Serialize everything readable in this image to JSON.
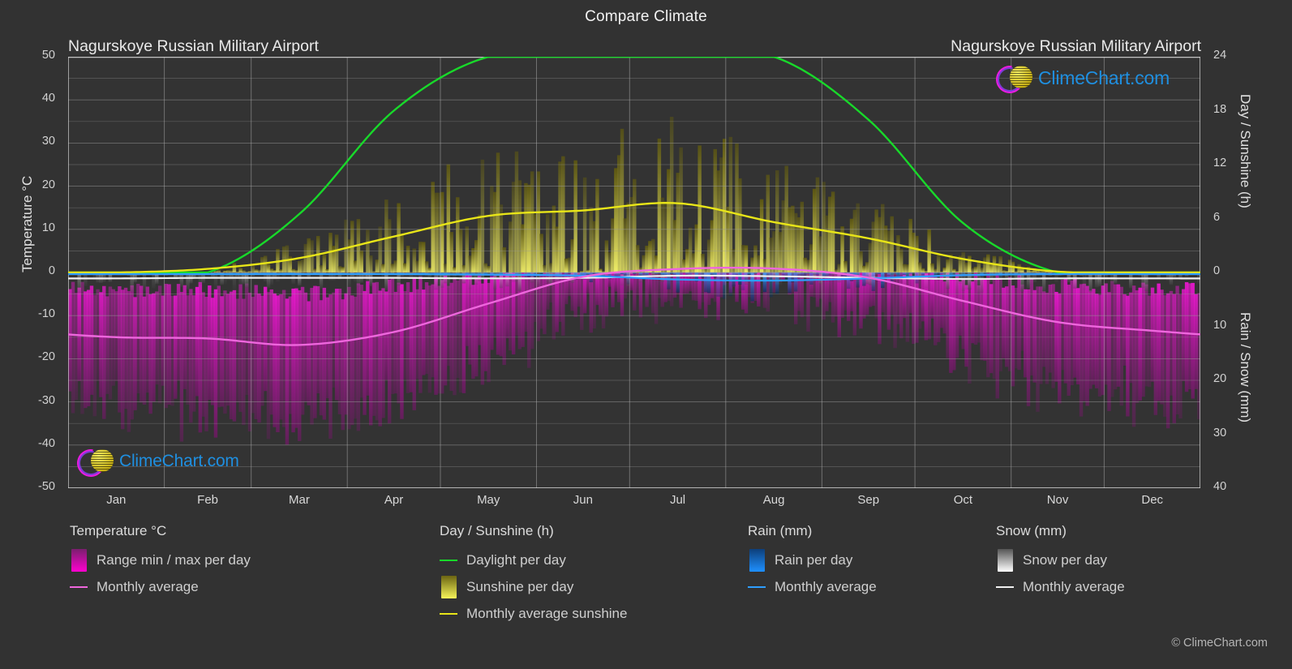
{
  "header": {
    "main_title": "Compare Climate",
    "station_left": "Nagurskoye Russian Military Airport",
    "station_right": "Nagurskoye Russian Military Airport"
  },
  "watermark": {
    "brand": "ClimeChart.com",
    "copyright": "© ClimeChart.com"
  },
  "axes": {
    "left_title": "Temperature °C",
    "right_title_top": "Day / Sunshine (h)",
    "right_title_bottom": "Rain / Snow (mm)",
    "left_ticks": [
      "50",
      "40",
      "30",
      "20",
      "10",
      "0",
      "-10",
      "-20",
      "-30",
      "-40",
      "-50"
    ],
    "right_ticks_top": [
      "24",
      "18",
      "12",
      "6",
      "0"
    ],
    "right_ticks_bottom": [
      "10",
      "20",
      "30",
      "40"
    ],
    "months": [
      "Jan",
      "Feb",
      "Mar",
      "Apr",
      "May",
      "Jun",
      "Jul",
      "Aug",
      "Sep",
      "Oct",
      "Nov",
      "Dec"
    ]
  },
  "legend": {
    "groups": [
      {
        "title": "Temperature °C",
        "items": [
          {
            "label": "Range min / max per day",
            "swatch": "gradient",
            "color": "#ff00d0",
            "color2": "#7a1f6e"
          },
          {
            "label": "Monthly average",
            "swatch": "line",
            "color": "#ee66dd"
          }
        ]
      },
      {
        "title": "Day / Sunshine (h)",
        "items": [
          {
            "label": "Daylight per day",
            "swatch": "line",
            "color": "#18d92a"
          },
          {
            "label": "Sunshine per day",
            "swatch": "gradient",
            "color": "#f6f45a",
            "color2": "#6b6412"
          },
          {
            "label": "Monthly average sunshine",
            "swatch": "line",
            "color": "#e8e518"
          }
        ]
      },
      {
        "title": "Rain (mm)",
        "items": [
          {
            "label": "Rain per day",
            "swatch": "gradient",
            "color": "#1e90ff",
            "color2": "#0d3f7a"
          },
          {
            "label": "Monthly average",
            "swatch": "line",
            "color": "#2e9eff"
          }
        ]
      },
      {
        "title": "Snow (mm)",
        "items": [
          {
            "label": "Snow per day",
            "swatch": "gradient",
            "color": "#ffffff",
            "color2": "#555555"
          },
          {
            "label": "Monthly average",
            "swatch": "line",
            "color": "#f0f0f0"
          }
        ]
      }
    ]
  },
  "chart_data": {
    "type": "line",
    "title": "Compare Climate",
    "subtitle": "Nagurskoye Russian Military Airport",
    "xlabel": "",
    "ylabel": "Temperature °C",
    "categories": [
      "Jan",
      "Feb",
      "Mar",
      "Apr",
      "May",
      "Jun",
      "Jul",
      "Aug",
      "Sep",
      "Oct",
      "Nov",
      "Dec"
    ],
    "axes": {
      "temperature_ylim": [
        -50,
        50
      ],
      "day_sunshine_ylim": [
        0,
        24
      ],
      "rain_snow_ylim": [
        0,
        40
      ],
      "grid": true,
      "legend_position": "bottom"
    },
    "series": [
      {
        "name": "Monthly average temperature",
        "unit": "°C",
        "color": "#ee66dd",
        "values": [
          -15.0,
          -15.3,
          -16.8,
          -13.8,
          -7.2,
          -1.0,
          0.8,
          0.9,
          -1.2,
          -6.6,
          -11.5,
          -13.5
        ]
      },
      {
        "name": "Daily min temperature (range low)",
        "unit": "°C",
        "color": "#7a1f6e",
        "values": [
          -27.0,
          -28.0,
          -30.0,
          -26.0,
          -16.0,
          -5.0,
          -1.5,
          -1.5,
          -6.0,
          -15.0,
          -22.0,
          -25.0
        ]
      },
      {
        "name": "Daily max temperature (range high)",
        "unit": "°C",
        "color": "#ff00d0",
        "values": [
          -4.0,
          -4.0,
          -5.0,
          -3.0,
          -1.0,
          2.0,
          4.0,
          4.0,
          2.0,
          -1.0,
          -3.0,
          -3.5
        ]
      },
      {
        "name": "Daylight per day",
        "unit": "h",
        "color": "#18d92a",
        "values": [
          0.0,
          0.0,
          6.5,
          18.0,
          24.0,
          24.0,
          24.0,
          24.0,
          17.0,
          5.5,
          0.0,
          0.0
        ]
      },
      {
        "name": "Monthly average sunshine",
        "unit": "h",
        "color": "#e8e518",
        "values": [
          0.0,
          0.4,
          1.6,
          4.0,
          6.3,
          6.9,
          7.7,
          5.6,
          3.8,
          1.5,
          0.1,
          0.0
        ]
      },
      {
        "name": "Monthly average rain",
        "unit": "mm",
        "color": "#2e9eff",
        "values": [
          0.3,
          0.3,
          0.3,
          0.3,
          0.4,
          0.6,
          1.3,
          1.5,
          1.1,
          0.5,
          0.3,
          0.3
        ]
      },
      {
        "name": "Monthly average snow",
        "unit": "mm",
        "color": "#f0f0f0",
        "values": [
          1.1,
          1.0,
          1.0,
          1.0,
          1.1,
          1.0,
          0.6,
          0.7,
          1.0,
          1.2,
          1.1,
          1.1
        ]
      }
    ]
  }
}
